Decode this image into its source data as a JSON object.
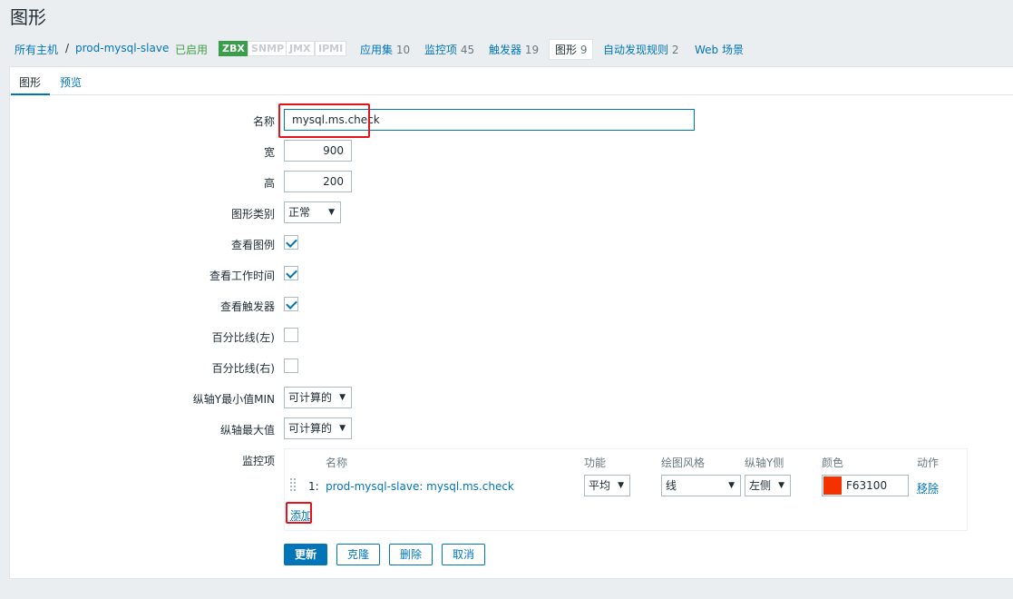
{
  "page": {
    "title": "图形"
  },
  "breadcrumb": {
    "all_hosts": "所有主机",
    "separator": "/",
    "host": "prod-mysql-slave",
    "status": "已启用",
    "badges": [
      "ZBX",
      "SNMP",
      "JMX",
      "IPMI"
    ],
    "applications": "应用集",
    "applications_count": "10",
    "items": "监控项",
    "items_count": "45",
    "triggers": "触发器",
    "triggers_count": "19",
    "graphs": "图形",
    "graphs_count": "9",
    "discovery": "自动发现规则",
    "discovery_count": "2",
    "web": "Web 场景"
  },
  "tabs": {
    "graph": "图形",
    "preview": "预览"
  },
  "form": {
    "name_label": "名称",
    "name_value": "mysql.ms.check",
    "width_label": "宽",
    "width_value": "900",
    "height_label": "高",
    "height_value": "200",
    "graph_type_label": "图形类别",
    "graph_type_value": "正常",
    "show_legend_label": "查看图例",
    "show_legend": true,
    "show_working_time_label": "查看工作时间",
    "show_working_time": true,
    "show_triggers_label": "查看触发器",
    "show_triggers": true,
    "percentile_left_label": "百分比线(左)",
    "percentile_left": false,
    "percentile_right_label": "百分比线(右)",
    "percentile_right": false,
    "ymin_label": "纵轴Y最小值MIN",
    "ymin_value": "可计算的",
    "ymax_label": "纵轴最大值",
    "ymax_value": "可计算的",
    "items_label": "监控项"
  },
  "items_table": {
    "headers": {
      "name": "名称",
      "function": "功能",
      "draw_style": "绘图风格",
      "y_axis": "纵轴Y侧",
      "color": "颜色",
      "action": "动作"
    },
    "rows": [
      {
        "index": "1:",
        "name": "prod-mysql-slave: mysql.ms.check",
        "function": "平均",
        "draw_style": "线",
        "y_axis": "左侧",
        "color": "F63100",
        "action": "移除"
      }
    ],
    "add_label": "添加"
  },
  "buttons": {
    "update": "更新",
    "clone": "克隆",
    "delete": "删除",
    "cancel": "取消"
  },
  "colors": {
    "accent": "#0275b8",
    "enabled": "#429e47",
    "item_color": "#F63100",
    "highlight": "#e3141b"
  }
}
